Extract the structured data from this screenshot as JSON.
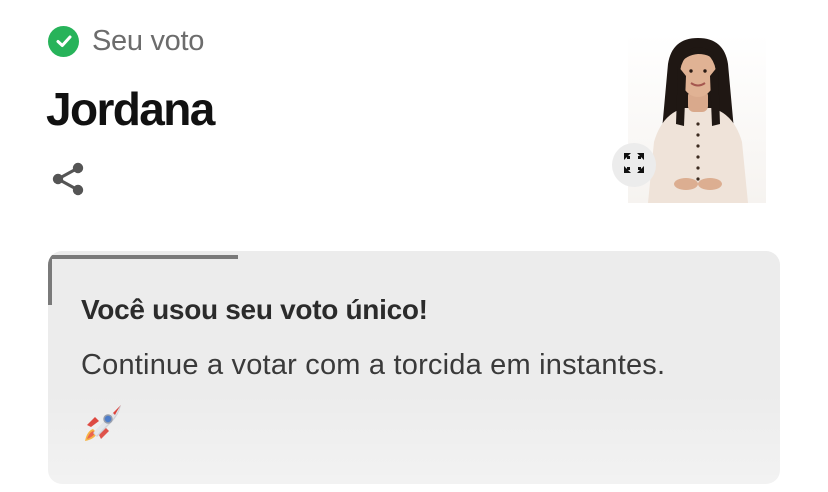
{
  "vote": {
    "status_label": "Seu voto",
    "candidate_name": "Jordana"
  },
  "icons": {
    "status": "check-circle-icon",
    "share": "share-icon",
    "expand": "expand-icon",
    "rocket": "rocket-icon"
  },
  "card": {
    "title": "Você usou seu voto único!",
    "message": "Continue a votar com a torcida em instantes."
  },
  "colors": {
    "check_green": "#27b35a",
    "card_background": "#ececec",
    "status_gray": "#6c6c6c"
  }
}
